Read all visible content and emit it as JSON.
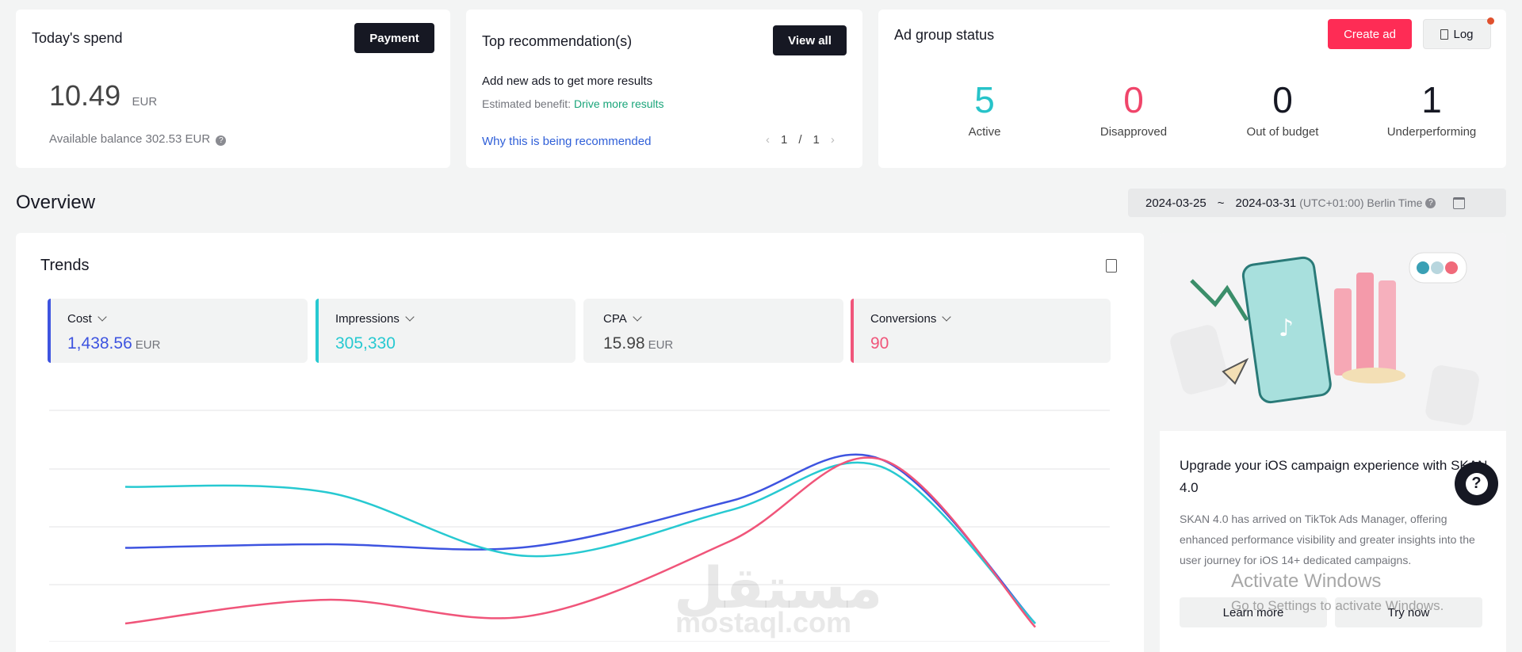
{
  "spend": {
    "title": "Today's spend",
    "payment_label": "Payment",
    "amount": "10.49",
    "currency": "EUR",
    "balance": "Available balance 302.53 EUR"
  },
  "recommendation": {
    "title": "Top recommendation(s)",
    "view_all_label": "View all",
    "headline": "Add new ads to get more results",
    "benefit_prefix": "Estimated benefit: ",
    "benefit_link": "Drive more results",
    "why_link": "Why this is being recommended",
    "page_current": "1",
    "page_sep": "/",
    "page_total": "1"
  },
  "ad_group_status": {
    "title": "Ad group status",
    "create_ad_label": "Create ad",
    "log_label": "Log",
    "stats": [
      {
        "value": "5",
        "label": "Active",
        "color": "#27c3c9"
      },
      {
        "value": "0",
        "label": "Disapproved",
        "color": "#f0456a"
      },
      {
        "value": "0",
        "label": "Out of budget",
        "color": "#161823"
      },
      {
        "value": "1",
        "label": "Underperforming",
        "color": "#161823"
      }
    ]
  },
  "overview": {
    "title": "Overview",
    "date_start": "2024-03-25",
    "date_sep": "~",
    "date_end": "2024-03-31",
    "timezone": "(UTC+01:00) Berlin Time"
  },
  "trends": {
    "title": "Trends",
    "metrics": [
      {
        "name": "Cost",
        "value": "1,438.56",
        "unit": "EUR",
        "color": "#3e54e0"
      },
      {
        "name": "Impressions",
        "value": "305,330",
        "unit": "",
        "color": "#27c9d1"
      },
      {
        "name": "CPA",
        "value": "15.98",
        "unit": "EUR",
        "color": "#161823"
      },
      {
        "name": "Conversions",
        "value": "90",
        "unit": "",
        "color": "#f0557a"
      }
    ]
  },
  "chart_data": {
    "type": "line",
    "series": [
      {
        "name": "Cost",
        "color": "#3e54e0",
        "values": [
          0.515,
          0.535,
          0.52,
          0.77,
          1.0,
          0.1
        ]
      },
      {
        "name": "Impressions",
        "color": "#27c9d1",
        "values": [
          0.85,
          0.82,
          0.47,
          0.72,
          0.96,
          0.1
        ]
      },
      {
        "name": "Conversions",
        "color": "#f0557a",
        "values": [
          0.1,
          0.23,
          0.14,
          0.55,
          1.0,
          0.08
        ]
      }
    ],
    "grid": true
  },
  "promo": {
    "title": "Upgrade your iOS campaign experience with SKAN 4.0",
    "body": "SKAN 4.0 has arrived on TikTok Ads Manager, offering enhanced performance visibility and greater insights into the user journey for iOS 14+ dedicated campaigns.",
    "learn_more": "Learn more",
    "try_now": "Try now"
  },
  "overlay": {
    "activate_title": "Activate Windows",
    "activate_sub": "Go to Settings to activate Windows.",
    "watermark_en": "mostaql.com",
    "watermark_ar": "مستقل"
  }
}
